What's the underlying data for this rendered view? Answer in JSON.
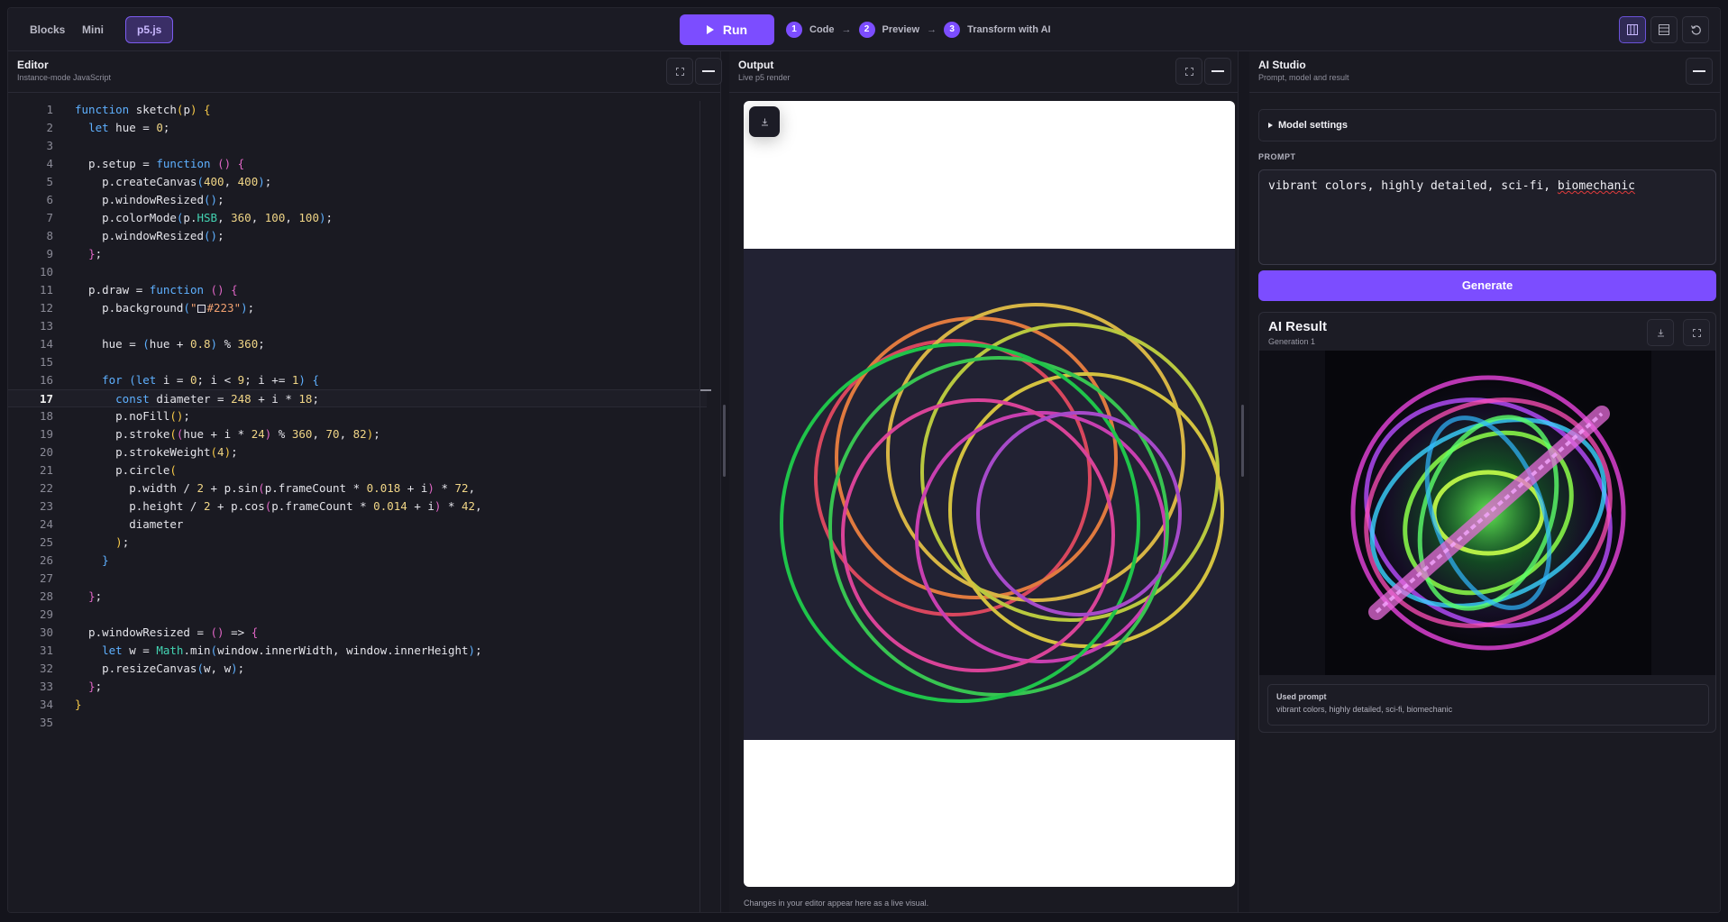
{
  "modes": [
    {
      "label": "Blocks",
      "active": false
    },
    {
      "label": "Mini",
      "active": false
    },
    {
      "label": "p5.js",
      "active": true
    }
  ],
  "run_label": "Run",
  "steps": [
    {
      "num": "1",
      "label": "Code"
    },
    {
      "num": "2",
      "label": "Preview"
    },
    {
      "num": "3",
      "label": "Transform with AI"
    }
  ],
  "editor": {
    "title": "Editor",
    "subtitle": "Instance-mode JavaScript",
    "current_line": 17
  },
  "output": {
    "title": "Output",
    "subtitle": "Live p5 render",
    "footer": "Changes in your editor appear here as a live visual."
  },
  "studio": {
    "title": "AI Studio",
    "subtitle": "Prompt, model and result",
    "model_settings_label": "Model settings",
    "prompt_label": "PROMPT",
    "prompt_value": "vibrant colors, highly detailed, sci-fi, biomechanic",
    "generate_label": "Generate",
    "result_title": "AI Result",
    "result_subtitle": "Generation 1",
    "used_prompt_label": "Used prompt",
    "used_prompt_text": "vibrant colors, highly detailed, sci-fi, biomechanic"
  },
  "colors": {
    "accent": "#7c4dff",
    "sketch_bg": "#223"
  }
}
